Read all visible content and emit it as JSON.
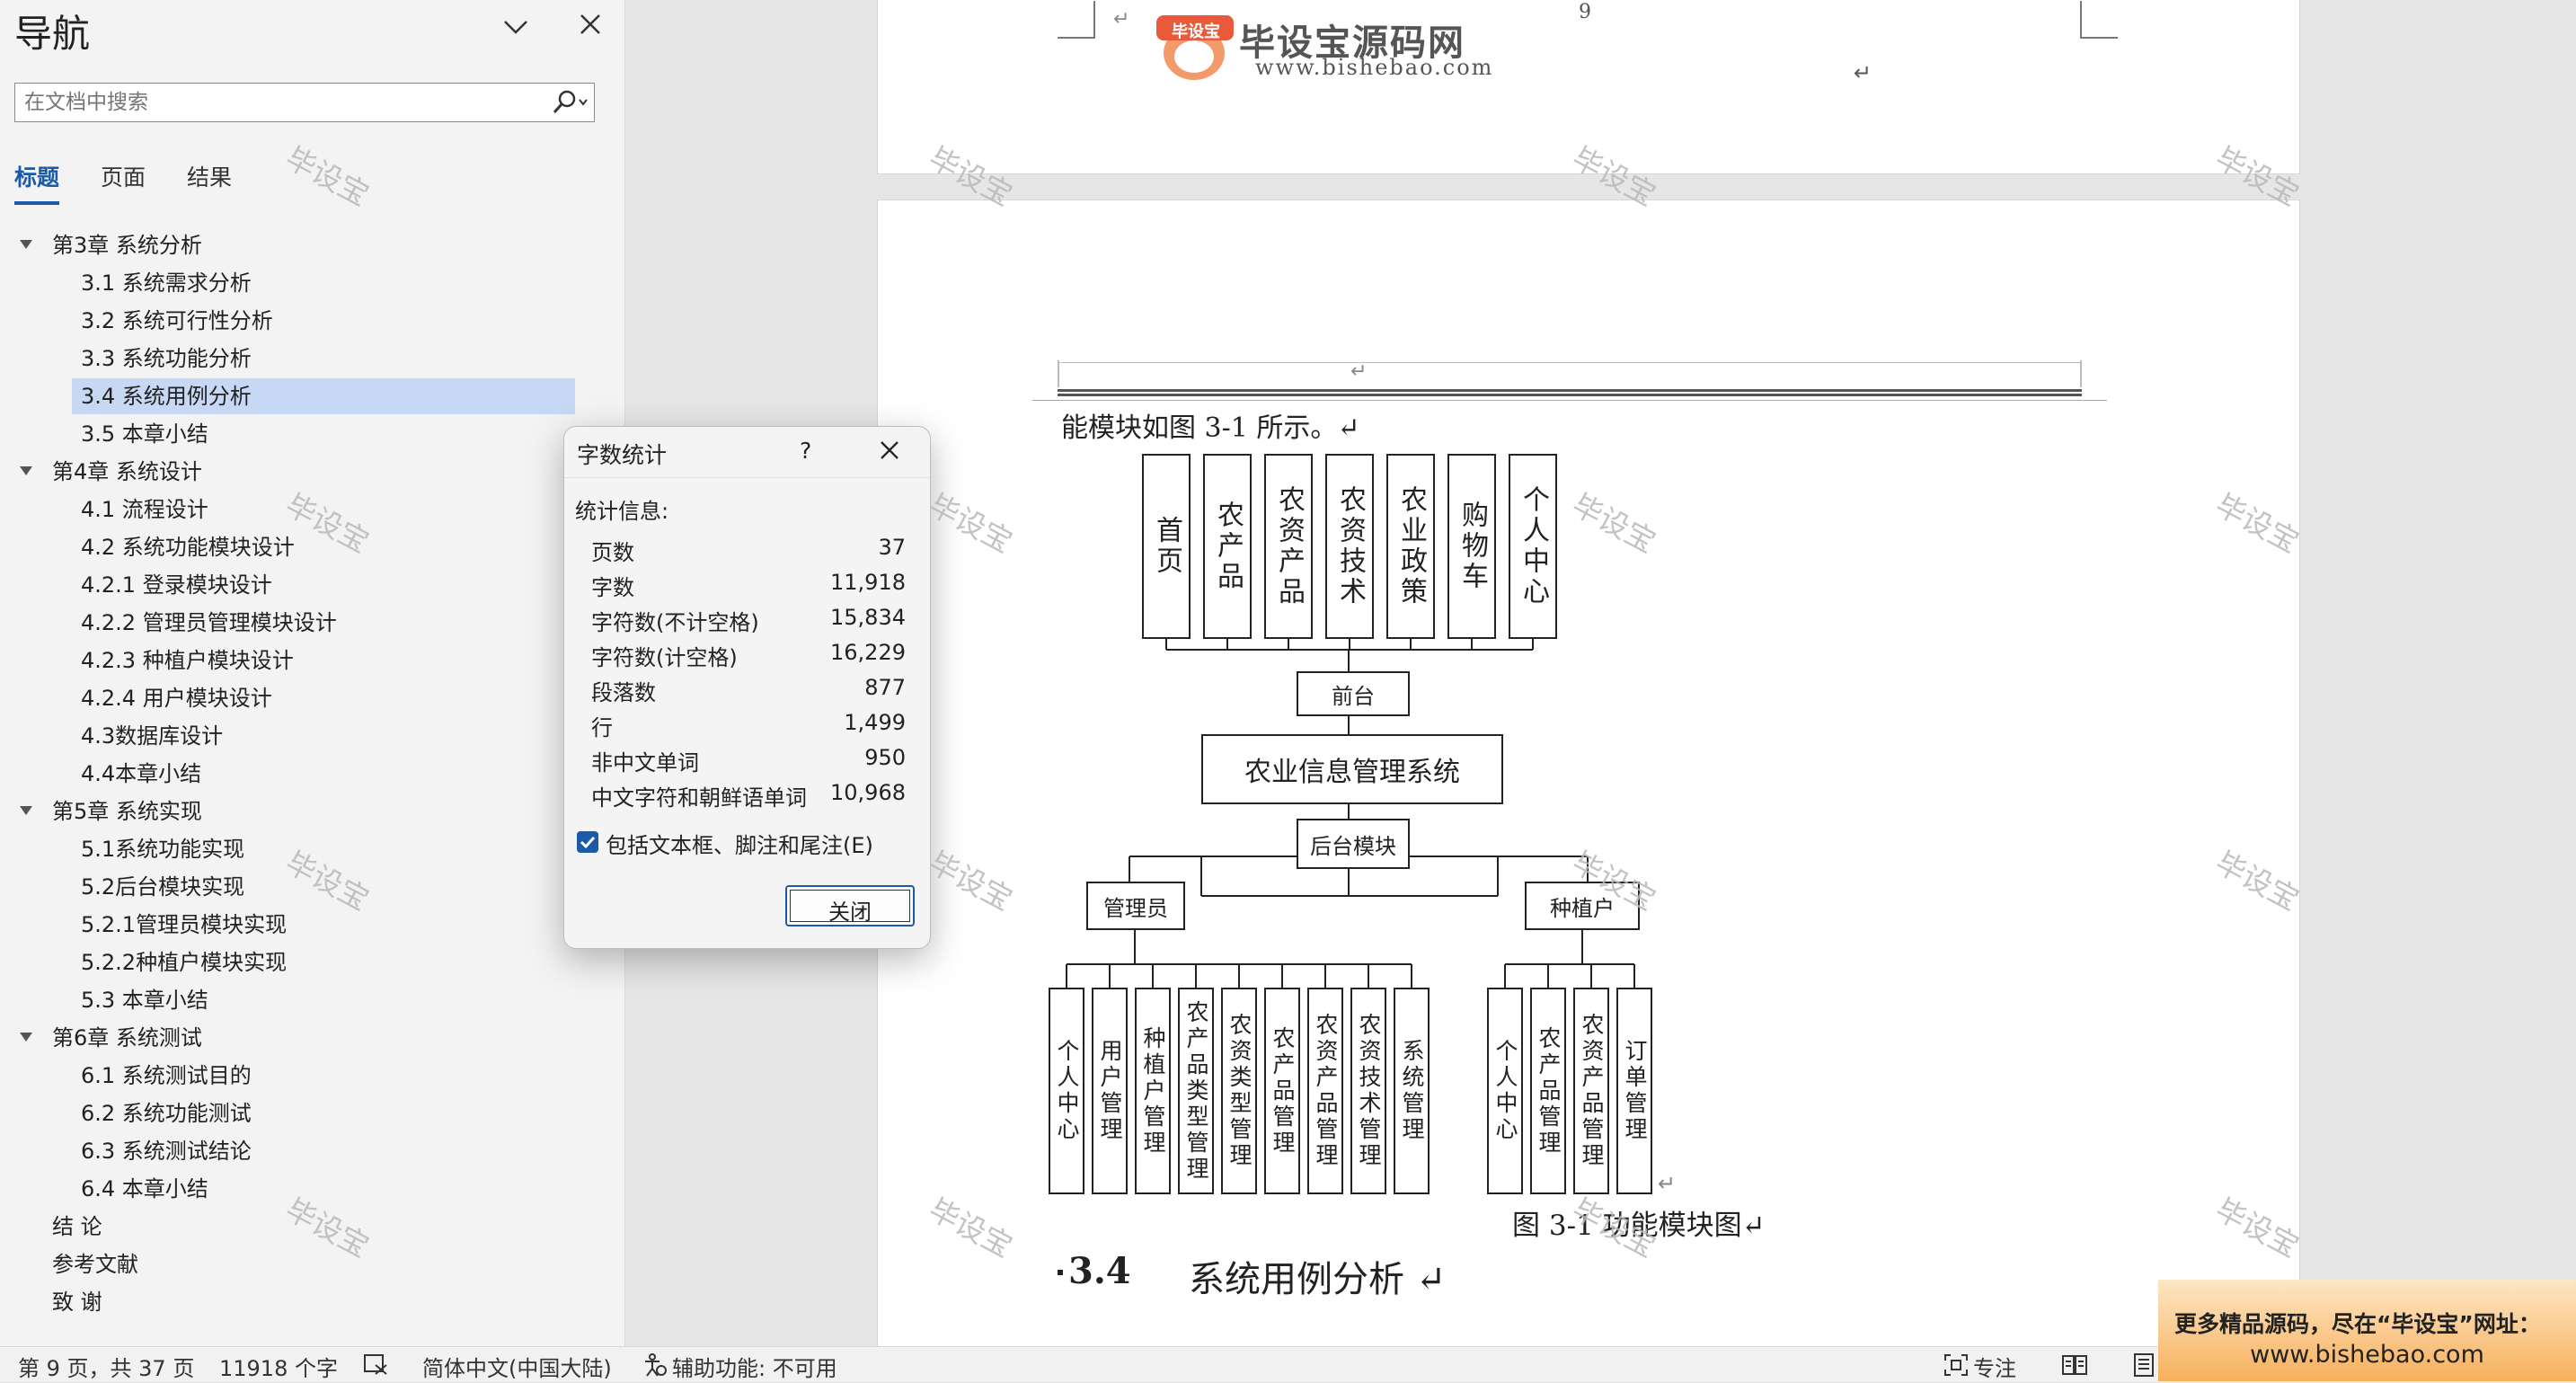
{
  "nav": {
    "title": "导航",
    "search_placeholder": "在文档中搜索",
    "tabs": [
      "标题",
      "页面",
      "结果"
    ],
    "headings": [
      {
        "text": "第3章 系统分析",
        "level": 1
      },
      {
        "text": "3.1 系统需求分析",
        "level": 2
      },
      {
        "text": "3.2 系统可行性分析",
        "level": 2
      },
      {
        "text": "3.3 系统功能分析",
        "level": 2
      },
      {
        "text": "3.4 系统用例分析",
        "level": 2,
        "selected": true
      },
      {
        "text": "3.5 本章小结",
        "level": 2
      },
      {
        "text": "第4章 系统设计",
        "level": 1
      },
      {
        "text": "4.1 流程设计",
        "level": 2
      },
      {
        "text": "4.2 系统功能模块设计",
        "level": 2
      },
      {
        "text": "4.2.1 登录模块设计",
        "level": 2
      },
      {
        "text": "4.2.2 管理员管理模块设计",
        "level": 2
      },
      {
        "text": "4.2.3 种植户模块设计",
        "level": 2
      },
      {
        "text": "4.2.4 用户模块设计",
        "level": 2
      },
      {
        "text": "4.3数据库设计",
        "level": 2
      },
      {
        "text": "4.4本章小结",
        "level": 2
      },
      {
        "text": "第5章 系统实现",
        "level": 1
      },
      {
        "text": "5.1系统功能实现",
        "level": 2
      },
      {
        "text": "5.2后台模块实现",
        "level": 2
      },
      {
        "text": "5.2.1管理员模块实现",
        "level": 2
      },
      {
        "text": "5.2.2种植户模块实现",
        "level": 2
      },
      {
        "text": "5.3 本章小结",
        "level": 2
      },
      {
        "text": "第6章 系统测试",
        "level": 1
      },
      {
        "text": "6.1 系统测试目的",
        "level": 2
      },
      {
        "text": "6.2 系统功能测试",
        "level": 2
      },
      {
        "text": "6.3 系统测试结论",
        "level": 2
      },
      {
        "text": "6.4 本章小结",
        "level": 2
      },
      {
        "text": "结 论",
        "level": 0
      },
      {
        "text": "参考文献",
        "level": 0
      },
      {
        "text": "致 谢",
        "level": 0
      }
    ]
  },
  "watermark": {
    "text": "毕设宝"
  },
  "logo": {
    "badge": "毕设宝",
    "name": "毕设宝源码网",
    "url": "www.bishebao.com"
  },
  "page_top": {
    "page_number": "9",
    "mark": "↵"
  },
  "doc": {
    "intro_text": "能模块如图 3-1 所示。↵",
    "return_mark": "↵",
    "diagram": {
      "top_modules": [
        "首页",
        "农产品",
        "农资产品",
        "农资技术",
        "农业政策",
        "购物车",
        "个人中心"
      ],
      "frontend": "前台",
      "system": "农业信息管理系统",
      "backend": "后台模块",
      "admin": "管理员",
      "grower": "种植户",
      "admin_modules": [
        "个人中心",
        "用户管理",
        "种植户管理",
        "农产品类型管理",
        "农资类型管理",
        "农产品管理",
        "农资产品管理",
        "农资技术管理",
        "系统管理"
      ],
      "grower_modules": [
        "个人中心",
        "农产品管理",
        "农资产品管理",
        "订单管理"
      ]
    },
    "caption": "图 3-1 功能模块图↵",
    "section_number": "3.4",
    "section_title": "系统用例分析 ↵"
  },
  "dialog": {
    "title": "字数统计",
    "help": "?",
    "section_label": "统计信息:",
    "stats": [
      {
        "label": "页数",
        "value": "37"
      },
      {
        "label": "字数",
        "value": "11,918"
      },
      {
        "label": "字符数(不计空格)",
        "value": "15,834"
      },
      {
        "label": "字符数(计空格)",
        "value": "16,229"
      },
      {
        "label": "段落数",
        "value": "877"
      },
      {
        "label": "行",
        "value": "1,499"
      },
      {
        "label": "非中文单词",
        "value": "950"
      },
      {
        "label": "中文字符和朝鲜语单词",
        "value": "10,968"
      }
    ],
    "checkbox_label": "包括文本框、脚注和尾注(E)",
    "checkbox_checked": true,
    "close_label": "关闭"
  },
  "status": {
    "page": "第 9 页，共 37 页",
    "words": "11918 个字",
    "language": "简体中文(中国大陆)",
    "accessibility": "辅助功能: 不可用",
    "focus": "专注"
  },
  "promo": {
    "line1": "更多精品源码，尽在“毕设宝”网址：",
    "line2": "www.bishebao.com"
  },
  "colors": {
    "accent": "#1a5aa8",
    "selection": "#c6d8f3",
    "promo": "#f6b05c"
  }
}
